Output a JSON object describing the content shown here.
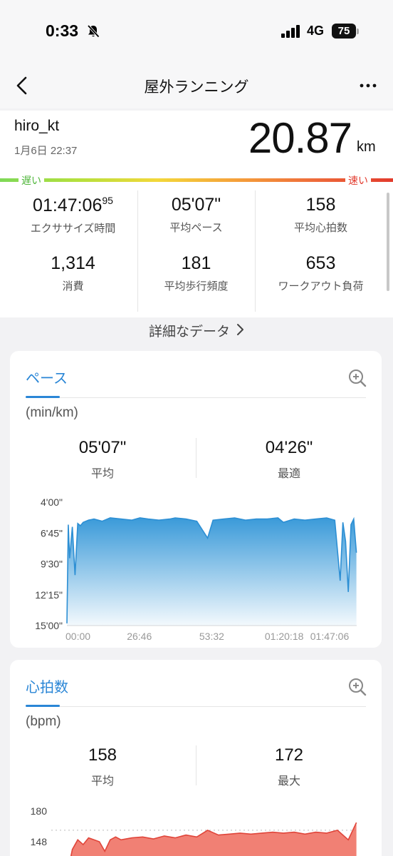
{
  "status_bar": {
    "time": "0:33",
    "network": "4G",
    "battery": "75"
  },
  "nav": {
    "title": "屋外ランニング"
  },
  "summary": {
    "user": "hiro_kt",
    "date": "1月6日 22:37",
    "distance": "20.87",
    "distance_unit": "km",
    "slow_label": "遅い",
    "fast_label": "速い",
    "stats": [
      {
        "value": "01:47:06",
        "value_sup": "95",
        "label": "エクササイズ時間"
      },
      {
        "value": "05'07\"",
        "label": "平均ペース"
      },
      {
        "value": "158",
        "label": "平均心拍数"
      },
      {
        "value": "1,314",
        "label": "消費"
      },
      {
        "value": "181",
        "label": "平均歩行頻度"
      },
      {
        "value": "653",
        "label": "ワークアウト負荷"
      }
    ]
  },
  "detail_link": "詳細なデータ",
  "pace_card": {
    "title": "ペース",
    "unit": "(min/km)",
    "avg_value": "05'07\"",
    "avg_label": "平均",
    "best_value": "04'26\"",
    "best_label": "最適"
  },
  "hr_card": {
    "title": "心拍数",
    "unit": "(bpm)",
    "avg_value": "158",
    "avg_label": "平均",
    "max_value": "172",
    "max_label": "最大"
  },
  "colors": {
    "accent": "#2a86d6",
    "pace_fill": "#3a9ad9",
    "hr_fill": "#ee6a5c"
  },
  "chart_data": [
    {
      "type": "area",
      "ylabel": "min/km",
      "y_ticks": [
        "4'00\"",
        "6'45\"",
        "9'30\"",
        "12'15\"",
        "15'00\""
      ],
      "y_tick_minutes": [
        4.0,
        6.75,
        9.5,
        12.25,
        15.0
      ],
      "ylim_minutes": [
        15.0,
        4.0
      ],
      "x_ticks": [
        "00:00",
        "26:46",
        "53:32",
        "01:20:18",
        "01:47:06"
      ],
      "x_minutes": [
        0,
        0.5,
        1,
        2,
        3,
        4,
        5,
        6,
        8,
        10,
        13,
        16,
        20,
        24,
        27,
        30,
        34,
        38,
        40,
        44,
        48,
        52,
        54,
        58,
        62,
        66,
        70,
        74,
        78,
        80,
        84,
        88,
        92,
        96,
        99,
        101,
        102,
        103,
        104,
        105,
        106,
        107
      ],
      "y_pace_minutes": [
        14.8,
        6.0,
        9.0,
        6.2,
        10.5,
        5.9,
        6.1,
        5.8,
        5.6,
        5.5,
        5.7,
        5.4,
        5.5,
        5.6,
        5.4,
        5.5,
        5.6,
        5.5,
        5.4,
        5.5,
        5.7,
        7.2,
        5.6,
        5.5,
        5.4,
        5.6,
        5.5,
        5.5,
        5.4,
        5.8,
        5.5,
        5.6,
        5.5,
        5.4,
        5.6,
        11.0,
        5.8,
        7.5,
        12.0,
        6.0,
        5.5,
        8.5
      ]
    },
    {
      "type": "area",
      "ylabel": "bpm",
      "y_ticks": [
        "180",
        "148"
      ],
      "x_minutes": [
        0,
        2,
        4,
        6,
        8,
        10,
        12,
        14,
        16,
        18,
        20,
        24,
        28,
        32,
        36,
        40,
        44,
        48,
        52,
        56,
        60,
        64,
        68,
        72,
        76,
        80,
        84,
        88,
        92,
        96,
        100,
        104,
        107
      ],
      "bpm": [
        112,
        140,
        150,
        145,
        152,
        150,
        148,
        138,
        150,
        153,
        150,
        152,
        153,
        151,
        154,
        152,
        155,
        153,
        160,
        155,
        156,
        157,
        156,
        157,
        158,
        157,
        158,
        156,
        158,
        157,
        160,
        150,
        168
      ]
    }
  ]
}
